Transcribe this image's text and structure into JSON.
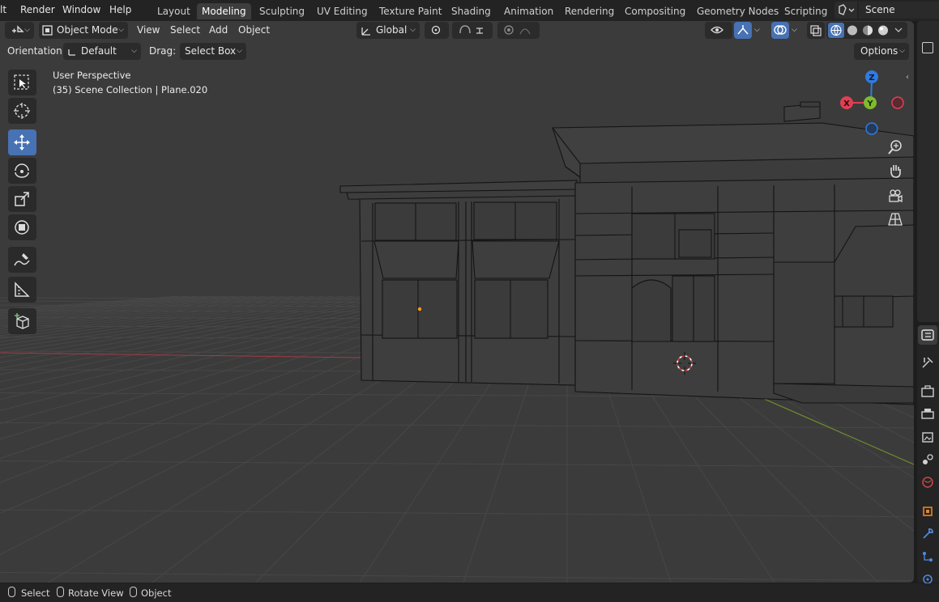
{
  "menu": [
    "lt",
    "Render",
    "Window",
    "Help"
  ],
  "workspaces": {
    "tabs": [
      "Layout",
      "Modeling",
      "Sculpting",
      "UV Editing",
      "Texture Paint",
      "Shading",
      "Animation",
      "Rendering",
      "Compositing",
      "Geometry Nodes",
      "Scripting"
    ],
    "active": "Modeling"
  },
  "scene": {
    "name": "Scene",
    "icon": "scene-icon"
  },
  "header": {
    "mode": "Object Mode",
    "menus": [
      "View",
      "Select",
      "Add",
      "Object"
    ],
    "transform_orientation": "Global"
  },
  "tool_settings": {
    "orientation_label": "Orientation:",
    "orientation_value": "Default",
    "drag_label": "Drag:",
    "drag_value": "Select Box",
    "options_label": "Options"
  },
  "overlay": {
    "perspective": "User Perspective",
    "collection": "(35) Scene Collection | Plane.020"
  },
  "tools": [
    {
      "name": "select-box-tool-icon",
      "active": false
    },
    {
      "name": "cursor-tool-icon",
      "active": false
    },
    {
      "name": "move-tool-icon",
      "active": true
    },
    {
      "name": "rotate-tool-icon",
      "active": false
    },
    {
      "name": "scale-tool-icon",
      "active": false
    },
    {
      "name": "transform-tool-icon",
      "active": false
    },
    {
      "name": "annotate-tool-icon",
      "active": false
    },
    {
      "name": "measure-tool-icon",
      "active": false
    },
    {
      "name": "add-cube-tool-icon",
      "active": false
    }
  ],
  "gizmo": {
    "x": "X",
    "y": "Y",
    "z": "Z",
    "x_color": "#e04052",
    "y_color": "#7fba2f",
    "z_color": "#2f7be0"
  },
  "status": {
    "select": "Select",
    "rotate": "Rotate View",
    "object": "Object"
  },
  "colors": {
    "accent": "#4772b3",
    "viewport_bg": "#3b3b3b",
    "grid": "#474747",
    "axis_x": "#a33a44",
    "axis_y": "#6f8f2c"
  }
}
